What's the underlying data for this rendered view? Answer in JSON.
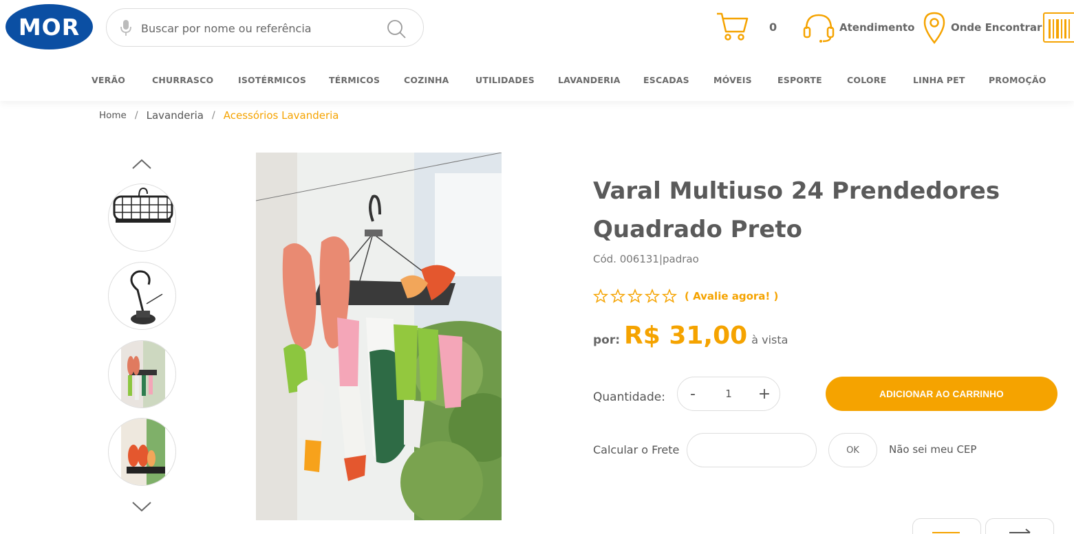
{
  "header": {
    "logo_text": "MOR",
    "search_placeholder": "Buscar por nome ou referência",
    "cart_count": "0",
    "atendimento": "Atendimento",
    "onde_encontrar": "Onde Encontrar"
  },
  "nav": [
    "VERÃO",
    "CHURRASCO",
    "ISOTÉRMICOS",
    "TÉRMICOS",
    "COZINHA",
    "UTILIDADES",
    "LAVANDERIA",
    "ESCADAS",
    "MÓVEIS",
    "ESPORTE",
    "COLORE",
    "LINHA PET",
    "PROMOÇÃO"
  ],
  "breadcrumb": {
    "home": "Home",
    "sep": "/",
    "level1": "Lavanderia",
    "current": "Acessórios Lavanderia"
  },
  "product": {
    "title": "Varal Multiuso 24 Prendedores Quadrado Preto",
    "code": "Cód. 006131|padrao",
    "rating_link": "( Avalie agora! )",
    "price_prefix": "por:",
    "price": "R$ 31,00",
    "price_suffix": "à vista",
    "quantity_label": "Quantidade:",
    "quantity_minus": "-",
    "quantity_value": "1",
    "quantity_plus": "+",
    "add_to_cart": "ADICIONAR AO CARRINHO",
    "frete_label": "Calcular o Frete",
    "ok_label": "OK",
    "nao_sei_cep": "Não sei meu CEP"
  },
  "colors": {
    "brand_blue": "#0b4fa3",
    "accent": "#f5a300"
  }
}
